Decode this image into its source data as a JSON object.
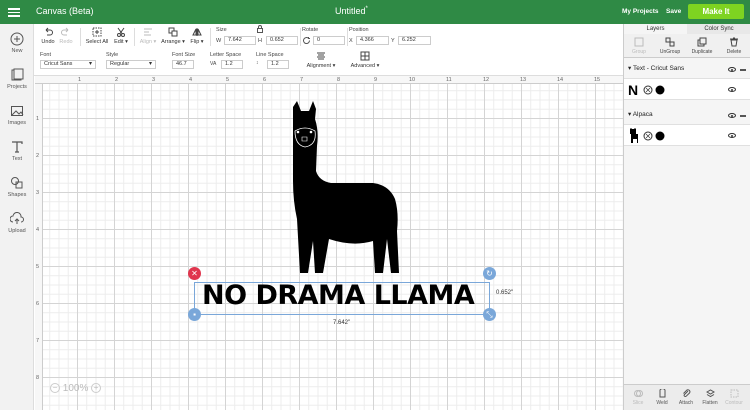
{
  "topbar": {
    "app_title": "Canvas (Beta)",
    "doc_title": "Untitled",
    "unsaved_mark": "*",
    "my_projects": "My Projects",
    "save": "Save",
    "make_it": "Make It"
  },
  "sidebar": {
    "items": [
      {
        "label": "New",
        "icon": "plus-circle-icon"
      },
      {
        "label": "Projects",
        "icon": "projects-icon"
      },
      {
        "label": "Images",
        "icon": "image-icon"
      },
      {
        "label": "Text",
        "icon": "text-icon"
      },
      {
        "label": "Shapes",
        "icon": "shapes-icon"
      },
      {
        "label": "Upload",
        "icon": "upload-icon"
      }
    ]
  },
  "toolbar": {
    "undo": "Undo",
    "redo": "Redo",
    "select_all": "Select All",
    "edit": "Edit",
    "align": "Align",
    "arrange": "Arrange",
    "flip": "Flip",
    "size_label": "Size",
    "w_label": "W",
    "w_value": "7.642",
    "h_label": "H",
    "h_value": "0.652",
    "rotate_label": "Rotate",
    "rotate_value": "0",
    "position_label": "Position",
    "x_label": "X",
    "x_value": "4.366",
    "y_label": "Y",
    "y_value": "6.252",
    "font_label": "Font",
    "font_value": "Cricut Sans",
    "style_label": "Style",
    "style_value": "Regular",
    "font_size_label": "Font Size",
    "font_size_value": "46.7",
    "letter_space_label": "Letter Space",
    "letter_space_value": "1.2",
    "line_space_label": "Line Space",
    "line_space_value": "1.2",
    "alignment": "Alignment",
    "advanced": "Advanced"
  },
  "canvas": {
    "ruler_top": [
      "1",
      "2",
      "3",
      "4",
      "5",
      "6",
      "7",
      "8",
      "9",
      "10",
      "11",
      "12",
      "13",
      "14",
      "15"
    ],
    "ruler_left": [
      "1",
      "2",
      "3",
      "4",
      "5",
      "6",
      "7",
      "8"
    ],
    "design_text": "NO DRAMA LLAMA",
    "width_dim": "7.642\"",
    "height_dim": "0.652\"",
    "zoom": "100%"
  },
  "panel": {
    "tab_layers": "Layers",
    "tab_color_sync": "Color Sync",
    "tools": {
      "group": "Group",
      "ungroup": "UnGroup",
      "duplicate": "Duplicate",
      "delete": "Delete"
    },
    "group1": {
      "title": "Text - Cricut Sans",
      "glyph": "N"
    },
    "group2": {
      "title": "Alpaca"
    },
    "bottom": {
      "slice": "Slice",
      "weld": "Weld",
      "attach": "Attach",
      "flatten": "Flatten",
      "contour": "Contour"
    }
  },
  "colors": {
    "brand_green": "#2f8a45",
    "make_it": "#7ed321",
    "handle_red": "#e0364e",
    "handle_blue": "#7aa7d9"
  }
}
